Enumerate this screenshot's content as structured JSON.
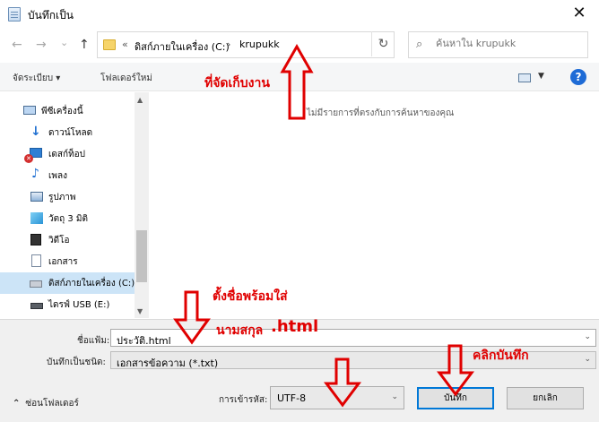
{
  "window": {
    "title": "บันทึกเป็น",
    "close_glyph": "✕"
  },
  "nav": {
    "back": "←",
    "forward": "→",
    "recent": "⌄",
    "up": "↑"
  },
  "address": {
    "overflow": "«",
    "crumbs": [
      "ดิสก์ภายในเครื่อง (C:)",
      "krupukk"
    ],
    "separator": "›"
  },
  "search": {
    "placeholder": "ค้นหาใน krupukk"
  },
  "toolbar": {
    "organize": "จัดระเบียบ ▾",
    "new_folder": "โฟลเดอร์ใหม่",
    "help": "?"
  },
  "sidebar": {
    "items": [
      {
        "label": "พีซีเครื่องนี้",
        "icon": "computer-icon"
      },
      {
        "label": "ดาวน์โหลด",
        "icon": "download-icon"
      },
      {
        "label": "เดสก์ท็อป",
        "icon": "desktop-icon"
      },
      {
        "label": "เพลง",
        "icon": "music-icon"
      },
      {
        "label": "รูปภาพ",
        "icon": "pictures-icon"
      },
      {
        "label": "วัตถุ 3 มิติ",
        "icon": "cube-icon"
      },
      {
        "label": "วิดีโอ",
        "icon": "video-icon"
      },
      {
        "label": "เอกสาร",
        "icon": "document-icon"
      },
      {
        "label": "ดิสก์ภายในเครื่อง (C:)",
        "icon": "drive-icon"
      },
      {
        "label": "ไดรฟ์ USB (E:)",
        "icon": "usb-drive-icon"
      }
    ]
  },
  "content": {
    "empty_message": "ไม่มีรายการที่ตรงกับการค้นหาของคุณ"
  },
  "form": {
    "filename_label": "ชื่อแฟ้ม:",
    "filename_value": "ประวัติ.html",
    "type_label": "บันทึกเป็นชนิด:",
    "type_value": "เอกสารข้อความ (*.txt)",
    "hide_folders": "ซ่อนโฟลเดอร์",
    "encoding_label": "การเข้ารหัส:",
    "encoding_value": "UTF-8",
    "save_button": "บันทึก",
    "cancel_button": "ยกเลิก"
  },
  "annotations": {
    "storage": "ที่จัดเก็บงาน",
    "name_line1": "ตั้งชื่อพร้อมใส่",
    "name_line2": "นามสกุล",
    "name_ext": ".html",
    "click_save": "คลิกบันทึก"
  },
  "colors": {
    "annotation": "#e00000",
    "selection": "#cce4f7",
    "accent": "#0078d7"
  }
}
